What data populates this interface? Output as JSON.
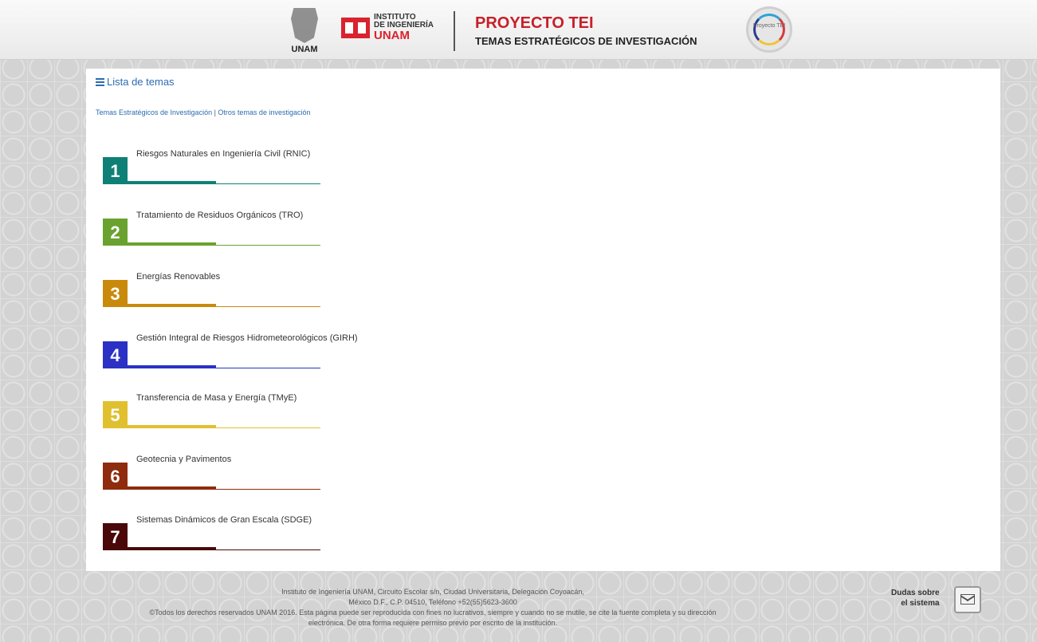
{
  "header": {
    "unam_label": "UNAM",
    "institute_line1": "INSTITUTO",
    "institute_line2": "DE INGENIERÍA",
    "institute_line3": "UNAM",
    "project_title": "PROYECTO TEI",
    "project_subtitle": "TEMAS ESTRATÉGICOS DE INVESTIGACIÓN",
    "badge_text": "Proyecto TEI"
  },
  "panel": {
    "list_title": "Lista de temas",
    "breadcrumb_a": "Temas Estratégicos de Investigación",
    "breadcrumb_sep": " | ",
    "breadcrumb_b": "Otros temas de investigación"
  },
  "topics": [
    {
      "number": "1",
      "label": "Riesgos Naturales en Ingeniería Civil (RNIC)",
      "color": "#0f8076"
    },
    {
      "number": "2",
      "label": "Tratamiento de Residuos Orgánicos (TRO)",
      "color": "#6aa230"
    },
    {
      "number": "3",
      "label": "Energías Renovables",
      "color": "#c98a0c"
    },
    {
      "number": "4",
      "label": "Gestión Integral de Riesgos Hidrometeorológicos (GIRH)",
      "color": "#2b31c4"
    },
    {
      "number": "5",
      "label": "Transferencia de Masa y Energía (TMyE)",
      "color": "#e0c02e"
    },
    {
      "number": "6",
      "label": "Geotecnia y Pavimentos",
      "color": "#8f2c0d"
    },
    {
      "number": "7",
      "label": "Sistemas Dinámicos de Gran Escala (SDGE)",
      "color": "#4a0808"
    }
  ],
  "footer": {
    "line1": "Instituto de Ingeniería UNAM, Circuito Escolar s/n, Ciudad Universitaria, Delegación Coyoacán,",
    "line2": "México D.F., C.P. 04510, Teléfono +52(55)5623-3600",
    "line3": "©Todos los derechos reservados UNAM 2016. Esta página puede ser reproducida con fines no lucrativos, siempre y cuando no se mutile, se cite la fuente completa y su dirección",
    "line4": "electrónica. De otra forma requiere permiso previo por escrito de la institución.",
    "help_line1": "Dudas sobre",
    "help_line2": "el sistema"
  }
}
